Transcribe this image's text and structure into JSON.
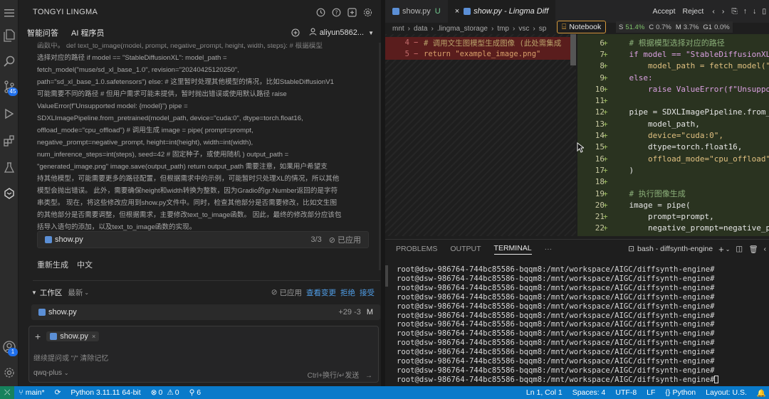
{
  "activity": {
    "scm_badge": "45",
    "account_badge": "1"
  },
  "lingma": {
    "title": "TONGYI LINGMA",
    "tabs": [
      "智能问答",
      "AI 程序员"
    ],
    "user": "aliyun5862...",
    "chat_lines": [
      "函数中。 def text_to_image(model, prompt, negative_prompt, height, width, steps): # 根据模型",
      "选择对应的路径 if model == \"StableDiffusionXL\": model_path =",
      "fetch_model(\"muse/sd_xl_base_1.0\", revision=\"20240425120250\",",
      "path=\"sd_xl_base_1.0.safetensors\") else: # 这里暂时处理其他模型的情况，比如StableDiffusionV1",
      "可能需要不同的路径 # 但用户需求可能未提供，暂时抛出错误或使用默认路径 raise",
      "ValueError(f\"Unsupported model: {model}\") pipe =",
      "SDXLImagePipeline.from_pretrained(model_path, device=\"cuda:0\", dtype=torch.float16,",
      "offload_mode=\"cpu_offload\") # 调用生成 image = pipe( prompt=prompt,",
      "negative_prompt=negative_prompt, height=int(height), width=int(width),",
      "num_inference_steps=int(steps), seed=42 # 固定种子，或使用随机 ) output_path =",
      "\"generated_image.png\" image.save(output_path) return output_path 需要注意，如果用户希望支",
      "持其他模型，可能需要更多的路径配置，但根据需求中的示例，可能暂时只处理XL的情况，所以其他",
      "模型会抛出错误。 此外，需要确保height和width转换为整数，因为Gradio的gr.Number返回的是字符",
      "串类型。 现在，将这些修改应用到show.py文件中。同时，检查其他部分是否需要修改，比如文生图",
      "的其他部分是否需要调整，但根据需求，主要修改text_to_image函数。 因此，最终的修改部分应该包",
      "括导入语句的添加，以及text_to_image函数的实现。"
    ],
    "file_card": {
      "name": "show.py",
      "count": "3/3",
      "status": "已应用"
    },
    "regen_label": "重新生成",
    "lang_label": "中文",
    "workspace": {
      "title": "工作区",
      "filter": "最新",
      "applied": "已应用",
      "view_changes": "查看变更",
      "reject": "拒绝",
      "accept": "接受",
      "file": "show.py",
      "diffstat": "+29 -3",
      "flag": "M"
    },
    "input": {
      "attached": "show.py",
      "placeholder": "继续提问或 \"/\" 清除记忆",
      "model": "qwq-plus",
      "send_hint": "Ctrl+换行/↵发送"
    }
  },
  "editor": {
    "tabs": [
      {
        "label": "show.py",
        "badge": "U"
      },
      {
        "label": "show.py - Lingma Diff"
      }
    ],
    "accept": "Accept",
    "reject": "Reject",
    "breadcrumb": [
      "mnt",
      "data",
      ".lingma_storage",
      "tmp",
      "vsc",
      "sp"
    ],
    "notebook": "Notebook",
    "stats": {
      "s": "S",
      "s_val": "51.4%",
      "c": "C",
      "c_val": "0.7%",
      "m": "M",
      "m_val": "3.7%",
      "g": "G1",
      "g_val": "0.0%"
    },
    "deleted": [
      {
        "num": "4",
        "code": "# 调用文生图模型生成图像 (此处需集成"
      },
      {
        "num": "5",
        "code": "return \"example_image.png\""
      }
    ],
    "code": [
      {
        "num": "6",
        "code": "    # 根据模型选择对应的路径"
      },
      {
        "num": "7",
        "code": "    if model == \"StableDiffusionXL"
      },
      {
        "num": "8",
        "code": "        model_path = fetch_model(\""
      },
      {
        "num": "9",
        "code": "    else:"
      },
      {
        "num": "10",
        "code": "        raise ValueError(f\"Unsuppo"
      },
      {
        "num": "11",
        "code": ""
      },
      {
        "num": "12",
        "code": "    pipe = SDXLImagePipeline.from_"
      },
      {
        "num": "13",
        "code": "        model_path,"
      },
      {
        "num": "14",
        "code": "        device=\"cuda:0\","
      },
      {
        "num": "15",
        "code": "        dtype=torch.float16,"
      },
      {
        "num": "16",
        "code": "        offload_mode=\"cpu_offload\""
      },
      {
        "num": "17",
        "code": "    )"
      },
      {
        "num": "18",
        "code": ""
      },
      {
        "num": "19",
        "code": "    # 执行图像生成"
      },
      {
        "num": "20",
        "code": "    image = pipe("
      },
      {
        "num": "21",
        "code": "        prompt=prompt,"
      },
      {
        "num": "22",
        "code": "        negative_prompt=negative_p"
      }
    ]
  },
  "panel": {
    "tabs": [
      "PROBLEMS",
      "OUTPUT",
      "TERMINAL"
    ],
    "more": "···",
    "terminal_name": "bash - diffsynth-engine",
    "prompt": "root@dsw-986764-744bc85586-bqqm8:/mnt/workspace/AIGC/diffsynth-engine#",
    "line_count": 13
  },
  "status": {
    "branch": "main*",
    "python": "Python 3.11.11 64-bit",
    "errors": "0",
    "warnings": "0",
    "ports": "6",
    "position": "Ln 1, Col 1",
    "spaces": "Spaces: 4",
    "encoding": "UTF-8",
    "eol": "LF",
    "language": "Python",
    "layout": "Layout: U.S."
  }
}
